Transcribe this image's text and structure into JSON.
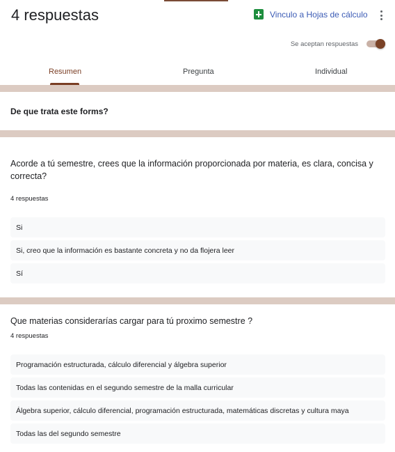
{
  "header": {
    "title": "4 respuestas",
    "sheets_link": "Vinculo a Hojas de cálculo",
    "more_icon": "more-vert-icon"
  },
  "accepting": {
    "label": "Se aceptan respuestas",
    "enabled": true
  },
  "tabs": [
    {
      "label": "Resumen",
      "active": true
    },
    {
      "label": "Pregunta",
      "active": false
    },
    {
      "label": "Individual",
      "active": false
    }
  ],
  "section": {
    "title": "De que trata este forms?"
  },
  "questions": [
    {
      "text": "Acorde a tú semestre, crees que la información proporcionada por materia, es clara, concisa y correcta?",
      "responses_count": "4 respuestas",
      "answers": [
        "Si",
        "Si, creo que la información es bastante concreta y no da flojera leer",
        "Sí"
      ]
    },
    {
      "text": "Que materias considerarías cargar para tú proximo semestre ?",
      "responses_count": "4 respuestas",
      "answers": [
        "Programación estructurada, cálculo diferencial y álgebra superior",
        "Todas las contenidas en el segundo semestre de la malla curricular",
        "Álgebra superior, cálculo diferencial, programación estructurada, matemáticas discretas y cultura maya",
        "Todas las del segundo semestre"
      ]
    }
  ],
  "colors": {
    "accent": "#7a3e24",
    "divider": "#dccbc2",
    "sheets_green": "#1e8e3e",
    "link_blue": "#3b5bb5"
  }
}
